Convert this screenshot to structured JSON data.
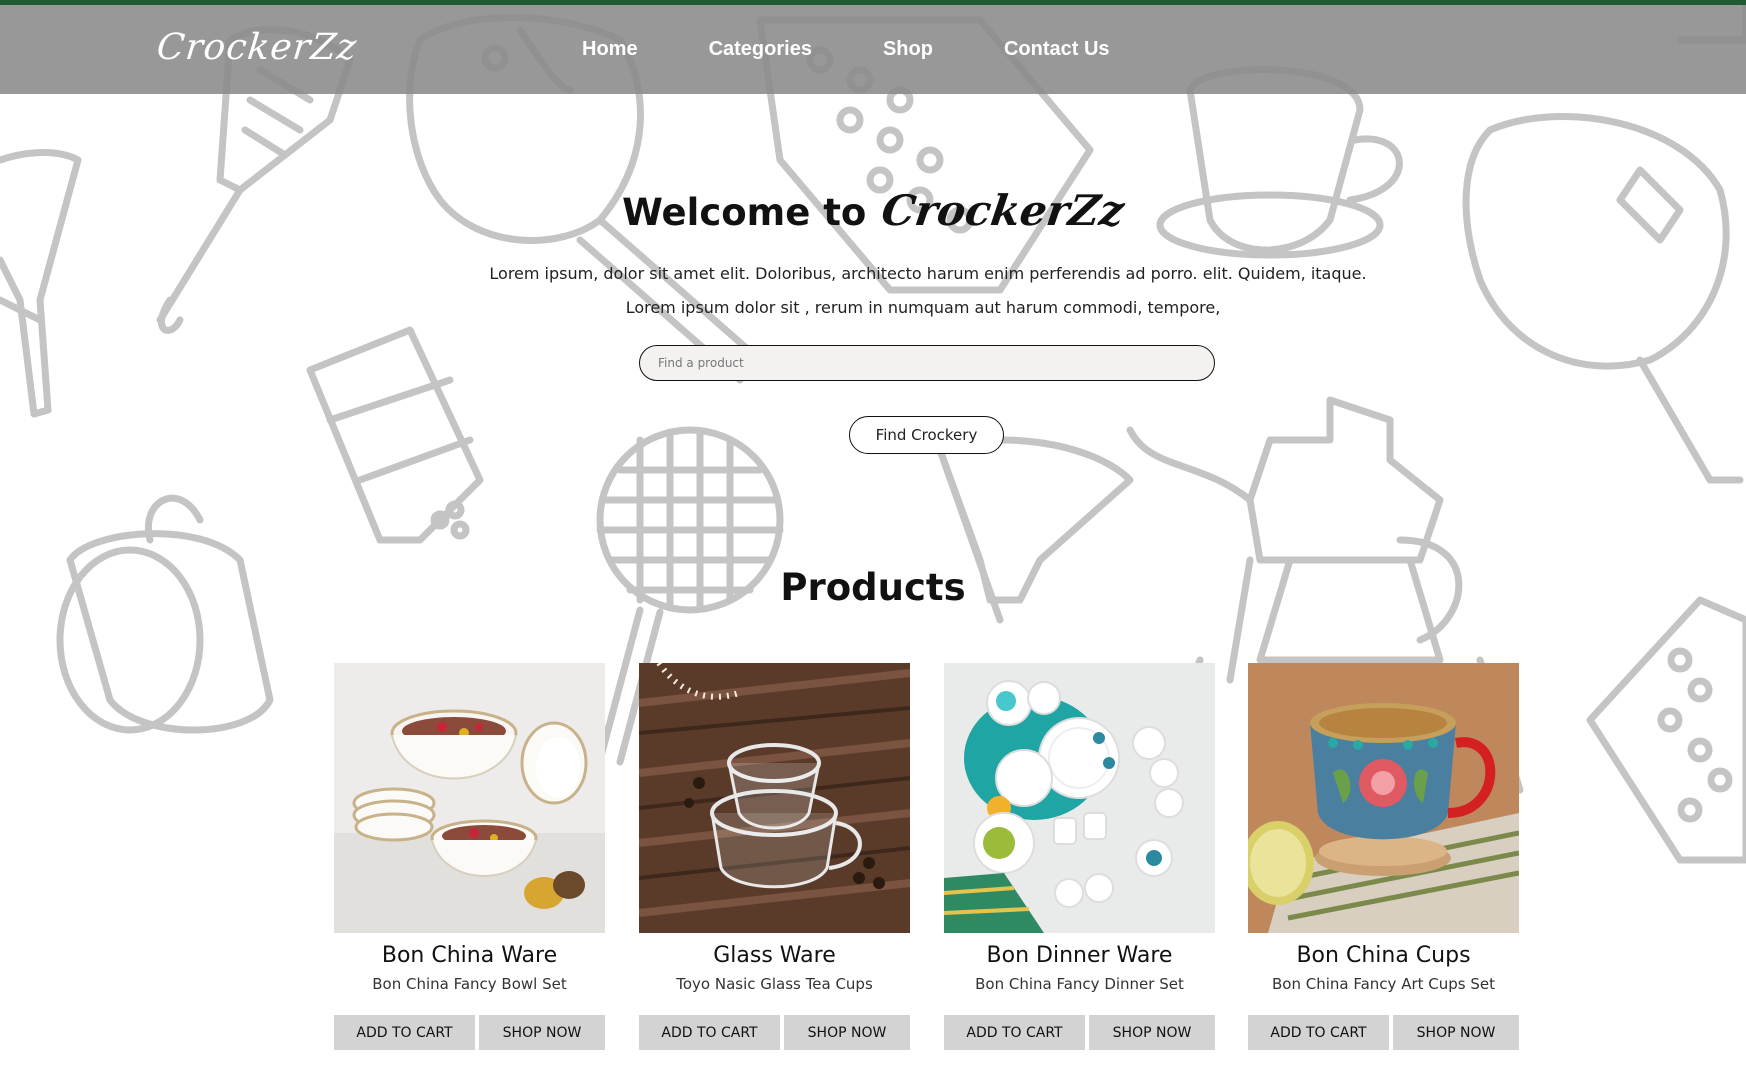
{
  "header": {
    "logo_text": "CrockerZz",
    "nav": [
      "Home",
      "Categories",
      "Shop",
      "Contact Us"
    ]
  },
  "hero": {
    "welcome": "Welcome to",
    "brand": "CrockerZz",
    "line1": "Lorem ipsum, dolor sit amet elit. Doloribus, architecto harum enim perferendis ad porro. elit. Quidem, itaque.",
    "line2": "Lorem ipsum dolor sit , rerum in numquam aut harum commodi, tempore,",
    "search_placeholder": "Find a product",
    "search_value": "",
    "button": "Find Crockery"
  },
  "products": {
    "title": "Products",
    "items": [
      {
        "name": "Bon China Ware",
        "desc": "Bon China Fancy Bowl Set",
        "cart": "ADD TO CART",
        "shop": "SHOP NOW"
      },
      {
        "name": "Glass Ware",
        "desc": "Toyo Nasic Glass Tea Cups",
        "cart": "ADD TO CART",
        "shop": "SHOP NOW"
      },
      {
        "name": "Bon Dinner Ware",
        "desc": "Bon China Fancy Dinner Set",
        "cart": "ADD TO CART",
        "shop": "SHOP NOW"
      },
      {
        "name": "Bon China Cups",
        "desc": "Bon China Fancy Art Cups Set",
        "cart": "ADD TO CART",
        "shop": "SHOP NOW"
      }
    ]
  },
  "colors": {
    "accent_bar": "#1f5a32",
    "header_bg": "#8a8a8a",
    "button_grey": "#d3d3d3",
    "doodle_stroke": "#c4c4c4"
  }
}
